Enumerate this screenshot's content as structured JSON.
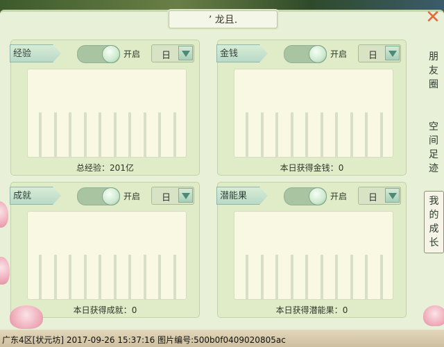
{
  "title": "’ 龙且.",
  "close_label": "✕",
  "sections": [
    {
      "name": "经验",
      "toggle_label": "开启",
      "period": "日",
      "summary_label": "总经验：",
      "summary_value": "201亿"
    },
    {
      "name": "金钱",
      "toggle_label": "开启",
      "period": "日",
      "summary_label": "本日获得金钱：",
      "summary_value": "0"
    },
    {
      "name": "成就",
      "toggle_label": "开启",
      "period": "日",
      "summary_label": "本日获得成就：",
      "summary_value": "0"
    },
    {
      "name": "潜能果",
      "toggle_label": "开启",
      "period": "日",
      "summary_label": "本日获得潜能果：",
      "summary_value": "0"
    }
  ],
  "side_tabs": [
    "朋友圈",
    "空间足迹",
    "我的成长"
  ],
  "active_side_tab": "我的成长",
  "footer": "广东4区[状元坊] 2017-09-26 15:37:16 图片编号:500b0f0409020805ac",
  "colors": {
    "panel": "#e9f0d8",
    "close": "#e06a3a",
    "accent": "#4b8a76"
  }
}
